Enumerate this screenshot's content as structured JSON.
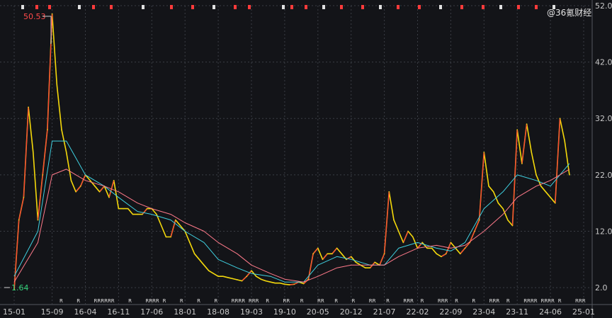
{
  "watermark": "@36氪财经",
  "colors": {
    "background": "#131418",
    "grid": "#3a3d44",
    "axis_text": "#c8c8c8",
    "price_up": "#ff3b3b",
    "price_down": "#f5d90a",
    "ma_short": "#ffffff",
    "ma_mid": "#e8d21c",
    "ma_long_a": "#33d17a",
    "ma_long_b": "#3fd0e0",
    "ma_long_c": "#ff7a8a",
    "max_label": "#ff4a4a",
    "min_label": "#33d17a",
    "mark_red": "#ff3b3b",
    "mark_white": "#e0e0e0"
  },
  "annotations": {
    "max_label": "50.53",
    "min_label": "1.64"
  },
  "chart_data": {
    "type": "line",
    "title": "",
    "xlabel": "",
    "ylabel": "",
    "ylim": [
      -1,
      52
    ],
    "y_ticks": [
      "52.0",
      "42.0",
      "32.0",
      "22.0",
      "12.0",
      "2.0"
    ],
    "y_tick_values": [
      52,
      42,
      32,
      22,
      12,
      2
    ],
    "x_ticks": [
      "15-01",
      "15-09",
      "16-04",
      "16-11",
      "17-06",
      "18-01",
      "18-08",
      "19-03",
      "19-10",
      "20-05",
      "20-12",
      "21-07",
      "22-02",
      "22-09",
      "23-04",
      "23-11",
      "24-06",
      "25-01"
    ],
    "grid": true,
    "scale": "linear",
    "max_point": {
      "x": "15-09",
      "y": 50.53
    },
    "min_point": {
      "x": "15-01",
      "y": 1.64
    },
    "bottom_markers": [
      "R",
      "R",
      "RRRRR",
      "R",
      "R",
      "RRRR",
      "R",
      "R",
      "R",
      "R",
      "RRRR",
      "RRR",
      "R",
      "RR",
      "R",
      "RR",
      "R",
      "R",
      "RR",
      "R",
      "RRR",
      "R",
      "RRR",
      "R",
      "R",
      "RRR",
      "R",
      "RRRR",
      "RRRR",
      "R",
      "RRR"
    ],
    "series": [
      {
        "x": [
          "15-01",
          "15-02",
          "15-03",
          "15-04",
          "15-05",
          "15-06",
          "15-07",
          "15-08",
          "15-09",
          "15-10",
          "15-11",
          "15-12",
          "16-01",
          "16-02",
          "16-03",
          "16-04",
          "16-05",
          "16-06",
          "16-07",
          "16-08",
          "16-09",
          "16-10",
          "16-11",
          "16-12",
          "17-01",
          "17-02",
          "17-03",
          "17-04",
          "17-05",
          "17-06",
          "17-07",
          "17-08",
          "17-09",
          "17-10",
          "17-11",
          "17-12",
          "18-01",
          "18-02",
          "18-03",
          "18-04",
          "18-05",
          "18-06",
          "18-07",
          "18-08",
          "18-09",
          "18-10",
          "18-11",
          "18-12",
          "19-01",
          "19-02",
          "19-03",
          "19-04",
          "19-05",
          "19-06",
          "19-07",
          "19-08",
          "19-09",
          "19-10",
          "19-11",
          "19-12",
          "20-01",
          "20-02",
          "20-03",
          "20-04",
          "20-05",
          "20-06",
          "20-07",
          "20-08",
          "20-09",
          "20-10",
          "20-11",
          "20-12",
          "21-01",
          "21-02",
          "21-03",
          "21-04",
          "21-05",
          "21-06",
          "21-07",
          "21-08",
          "21-09",
          "21-10",
          "21-11",
          "21-12",
          "22-01",
          "22-02",
          "22-03",
          "22-04",
          "22-05",
          "22-06",
          "22-07",
          "22-08",
          "22-09",
          "22-10",
          "22-11",
          "22-12",
          "23-01",
          "23-02",
          "23-03",
          "23-04",
          "23-05",
          "23-06",
          "23-07",
          "23-08",
          "23-09",
          "23-10",
          "23-11",
          "23-12",
          "24-01",
          "24-02",
          "24-03",
          "24-04",
          "24-05",
          "24-06",
          "24-07",
          "24-08",
          "24-09",
          "24-10"
        ],
        "values": [
          1.64,
          14,
          18,
          34,
          26,
          14,
          22,
          30,
          50.53,
          38,
          30,
          26,
          21,
          19,
          20,
          22,
          21,
          20,
          19,
          20,
          18,
          21,
          16,
          16,
          16,
          15,
          15,
          15,
          16,
          16,
          15,
          13,
          11,
          11,
          14,
          13,
          12,
          10,
          8,
          7,
          6,
          5,
          4.5,
          4,
          4,
          3.8,
          3.6,
          3.4,
          3.2,
          4,
          5,
          4,
          3.5,
          3.2,
          3,
          2.8,
          2.8,
          2.6,
          2.5,
          2.6,
          3,
          2.7,
          3.5,
          8,
          9,
          7,
          8,
          8,
          9,
          8,
          7,
          7.5,
          6.5,
          6,
          5.5,
          5.5,
          6.5,
          6,
          8,
          19,
          14,
          12,
          10,
          12,
          11,
          9,
          10,
          9,
          9,
          8,
          7.5,
          8,
          10,
          9,
          8,
          9,
          10,
          12,
          14,
          26,
          20,
          19,
          17,
          16,
          14,
          13,
          30,
          24,
          31,
          26,
          22,
          20,
          19,
          18,
          17,
          32,
          28,
          22
        ]
      },
      {
        "x": [
          "15-01",
          "15-06",
          "15-09",
          "15-12",
          "16-04",
          "16-08",
          "16-11",
          "17-03",
          "17-06",
          "17-10",
          "18-01",
          "18-05",
          "18-08",
          "18-12",
          "19-03",
          "19-07",
          "19-10",
          "20-02",
          "20-05",
          "20-09",
          "20-12",
          "21-04",
          "21-07",
          "21-10",
          "22-02",
          "22-06",
          "22-09",
          "22-12",
          "23-04",
          "23-08",
          "23-11",
          "24-03",
          "24-06",
          "24-10"
        ],
        "values": [
          4,
          12,
          28,
          28,
          22,
          20,
          18,
          15.5,
          15,
          14,
          12,
          10,
          7,
          5.5,
          4.5,
          4,
          3,
          3,
          6,
          7.5,
          7,
          6,
          6,
          9,
          10,
          9,
          8.5,
          10,
          16,
          19,
          22,
          21,
          20,
          24
        ]
      },
      {
        "x": [
          "15-01",
          "15-06",
          "15-09",
          "15-12",
          "16-04",
          "16-08",
          "16-11",
          "17-03",
          "17-06",
          "17-10",
          "18-01",
          "18-05",
          "18-08",
          "18-12",
          "19-03",
          "19-07",
          "19-10",
          "20-02",
          "20-05",
          "20-09",
          "20-12",
          "21-04",
          "21-07",
          "21-10",
          "22-02",
          "22-06",
          "22-09",
          "22-12",
          "23-04",
          "23-08",
          "23-11",
          "24-03",
          "24-06",
          "24-10"
        ],
        "values": [
          3,
          10,
          22,
          23,
          21,
          20,
          19,
          17,
          16,
          15,
          13.5,
          12,
          10,
          8,
          6,
          4.5,
          3.5,
          3,
          4,
          5.5,
          6,
          6,
          6,
          7.5,
          9,
          9.5,
          9,
          9.5,
          12,
          15,
          18,
          20,
          21,
          23
        ]
      }
    ]
  }
}
